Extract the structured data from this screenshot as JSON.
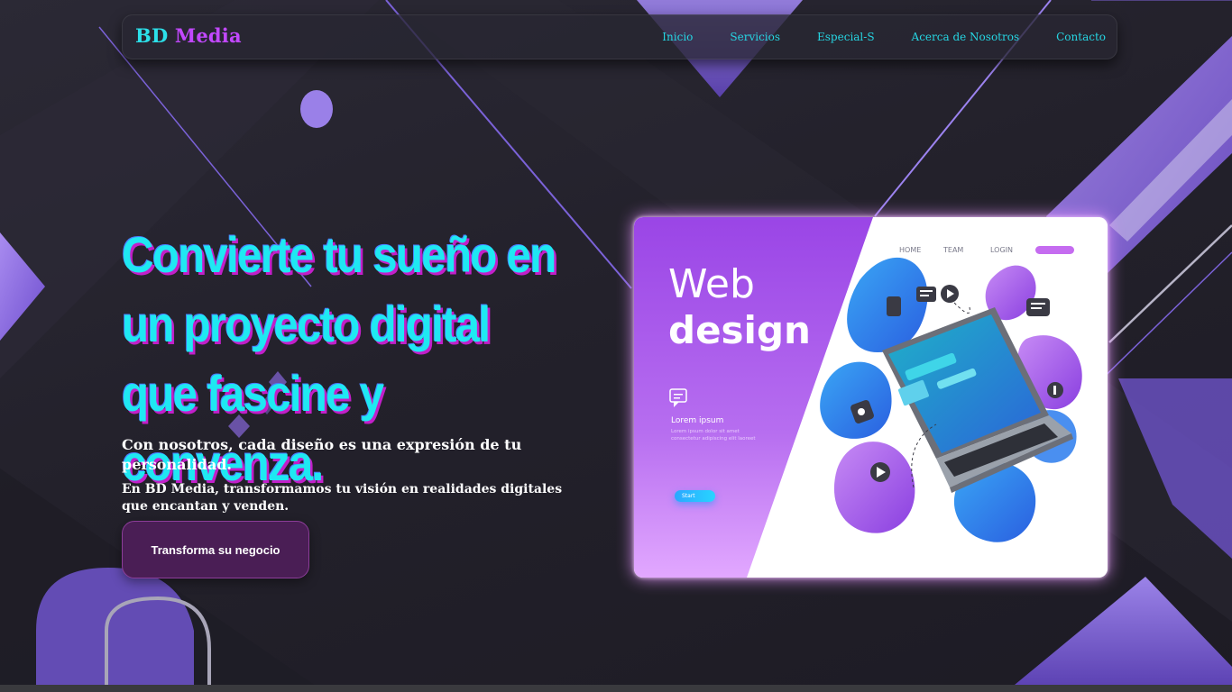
{
  "brand": {
    "bd": "BD",
    "media": "Media"
  },
  "nav": {
    "links": [
      "Inicio",
      "Servicios",
      "Especial-S",
      "Acerca de Nosotros",
      "Contacto"
    ]
  },
  "hero": {
    "title": "Convierte tu sueño en un proyecto digital que fascine y convenza.",
    "subtitle": "Con nosotros, cada diseño es una expresión de tu personalidad.",
    "description": "En BD Media, transformamos tu visión en realidades digitales que encantan y venden.",
    "cta_label": "Transforma su negocio"
  },
  "illustration": {
    "headline_light": "Web",
    "headline_bold": "design",
    "nav_items": [
      "HOME",
      "TEAM",
      "LOGIN"
    ],
    "lorem_title": "Lorem ipsum",
    "lorem_body": "Lorem ipsum dolor sit amet consectetur adipiscing elit laoreet",
    "start_button": "Start"
  },
  "colors": {
    "brand_cyan": "#2ce0ea",
    "brand_purple": "#c248ff",
    "title_cyan": "#1fe8f2",
    "title_shadow": "#c21fc9",
    "cta_bg": "#4a1e55",
    "accent_violet": "#8d6ee0"
  }
}
